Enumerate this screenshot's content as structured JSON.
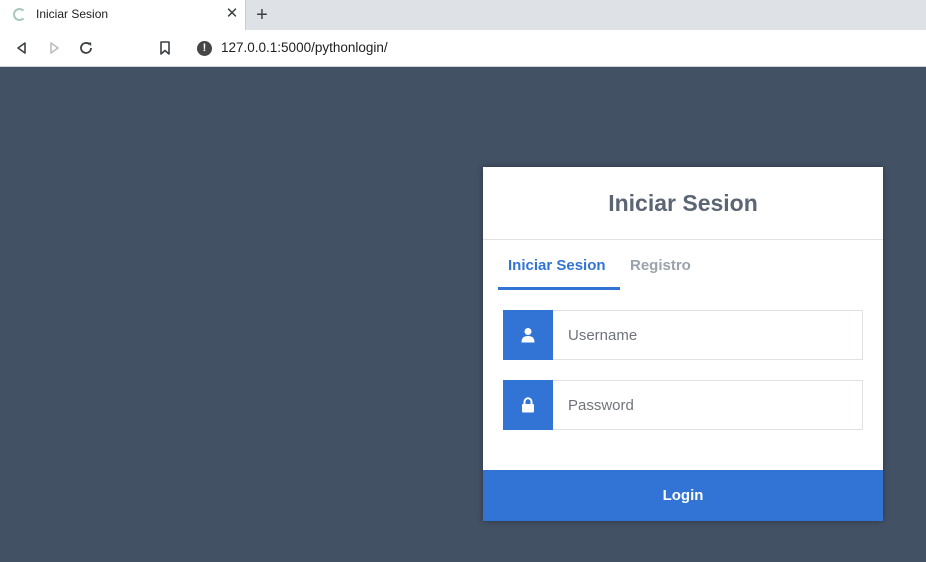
{
  "browser": {
    "tab_title": "Iniciar Sesion",
    "tab_close": "✕",
    "new_tab": "+",
    "url": "127.0.0.1:5000/pythonlogin/",
    "icons": {
      "favicon": "loading-spinner-icon",
      "info": "info-icon",
      "back": "back-arrow-icon",
      "forward": "forward-arrow-icon",
      "reload": "reload-icon",
      "bookmark": "bookmark-icon"
    }
  },
  "login": {
    "title": "Iniciar Sesion",
    "tabs": [
      {
        "label": "Iniciar Sesion",
        "active": true
      },
      {
        "label": "Registro",
        "active": false
      }
    ],
    "username": {
      "placeholder": "Username",
      "value": "",
      "icon": "user-icon"
    },
    "password": {
      "placeholder": "Password",
      "value": "",
      "icon": "lock-icon"
    },
    "submit_label": "Login"
  },
  "colors": {
    "background": "#435165",
    "accent": "#3274d6",
    "title_text": "#5b6574",
    "inactive_tab": "#9aa2ac"
  }
}
